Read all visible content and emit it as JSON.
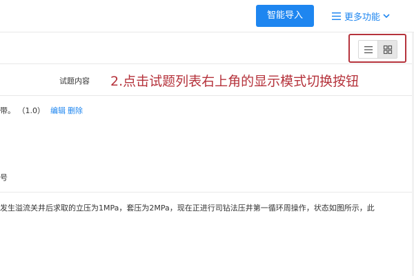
{
  "toolbar": {
    "import_label": "智能导入",
    "more_label": "更多功能",
    "more_icon": "menu-lines-icon",
    "more_chevron": "chevron-down-icon"
  },
  "view_toggle": {
    "list_icon": "list-view-icon",
    "grid_icon": "grid-view-icon",
    "active": "grid"
  },
  "header": {
    "column_label": "试题内容"
  },
  "annotation": {
    "text": "2.点击试题列表右上角的显示模式切换按钮",
    "color": "#b5323b"
  },
  "rows": [
    {
      "text": "带。",
      "score": "（1.0）",
      "edit_label": "编辑",
      "delete_label": "删除",
      "sub_text": "号"
    },
    {
      "text": "发生溢流关井后求取的立压为1MPa，套压为2MPa，现在正进行司钻法压井第一循环周操作，状态如图所示，此"
    }
  ],
  "colors": {
    "primary": "#1e86f0",
    "border": "#e8e8e8"
  }
}
